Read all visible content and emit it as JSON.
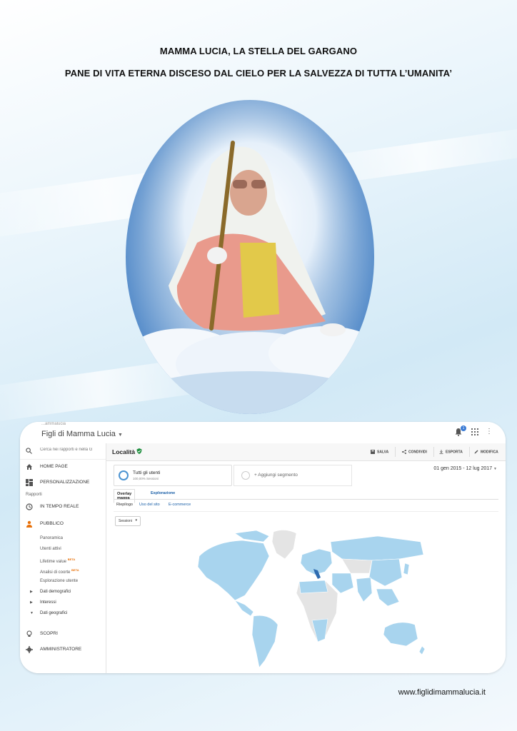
{
  "header": {
    "title_line_1": "MAMMA LUCIA, LA STELLA DEL GARGANO",
    "title_line_2": "PANE DI VITA ETERNA DISCESO DAL CIELO PER LA SALVEZZA DI TUTTA L’UMANITA’"
  },
  "analytics": {
    "breadcrumb": "...ammalucia",
    "app_title": "Figli di Mamma Lucia",
    "notification_count": "1",
    "search": {
      "placeholder": "Cerca nei rapporti e nella G"
    },
    "sidebar": {
      "home": "HOME PAGE",
      "custom": "PERSONALIZZAZIONE",
      "reports_section": "Rapporti",
      "realtime": "IN TEMPO REALE",
      "audience": "PUBBLICO",
      "sub_items": [
        "Panoramica",
        "Utenti attivi",
        "Lifetime value",
        "Analisi di coorte",
        "Esplorazione utente"
      ],
      "beta": "BETA",
      "tree": [
        "Dati demografici",
        "Interessi",
        "Dati geografici"
      ],
      "discover": "SCOPRI",
      "admin": "AMMINISTRATORE"
    },
    "main": {
      "page_title": "Località",
      "actions": [
        "SALVA",
        "CONDIVIDI",
        "ESPORTA",
        "MODIFICA"
      ],
      "segment": {
        "name": "Tutti gli utenti",
        "sub": "100,00% Sessioni"
      },
      "add_segment": "+ Aggiungi segmento",
      "date_range": "01 gen 2015 - 12 lug 2017",
      "tabs": [
        "Overlay mappa",
        "Esplorazione"
      ],
      "subtabs": [
        "Riepilogo",
        "Uso del sito",
        "E-commerce"
      ],
      "metric": "Sessioni"
    },
    "colors": {
      "map_fill": "#a8d4ee",
      "map_empty": "#e4e4e4",
      "map_highlight": "#2e6bb0",
      "accent": "#4b93d1"
    }
  },
  "footer": {
    "url": "www.figlidimammalucia.it"
  }
}
